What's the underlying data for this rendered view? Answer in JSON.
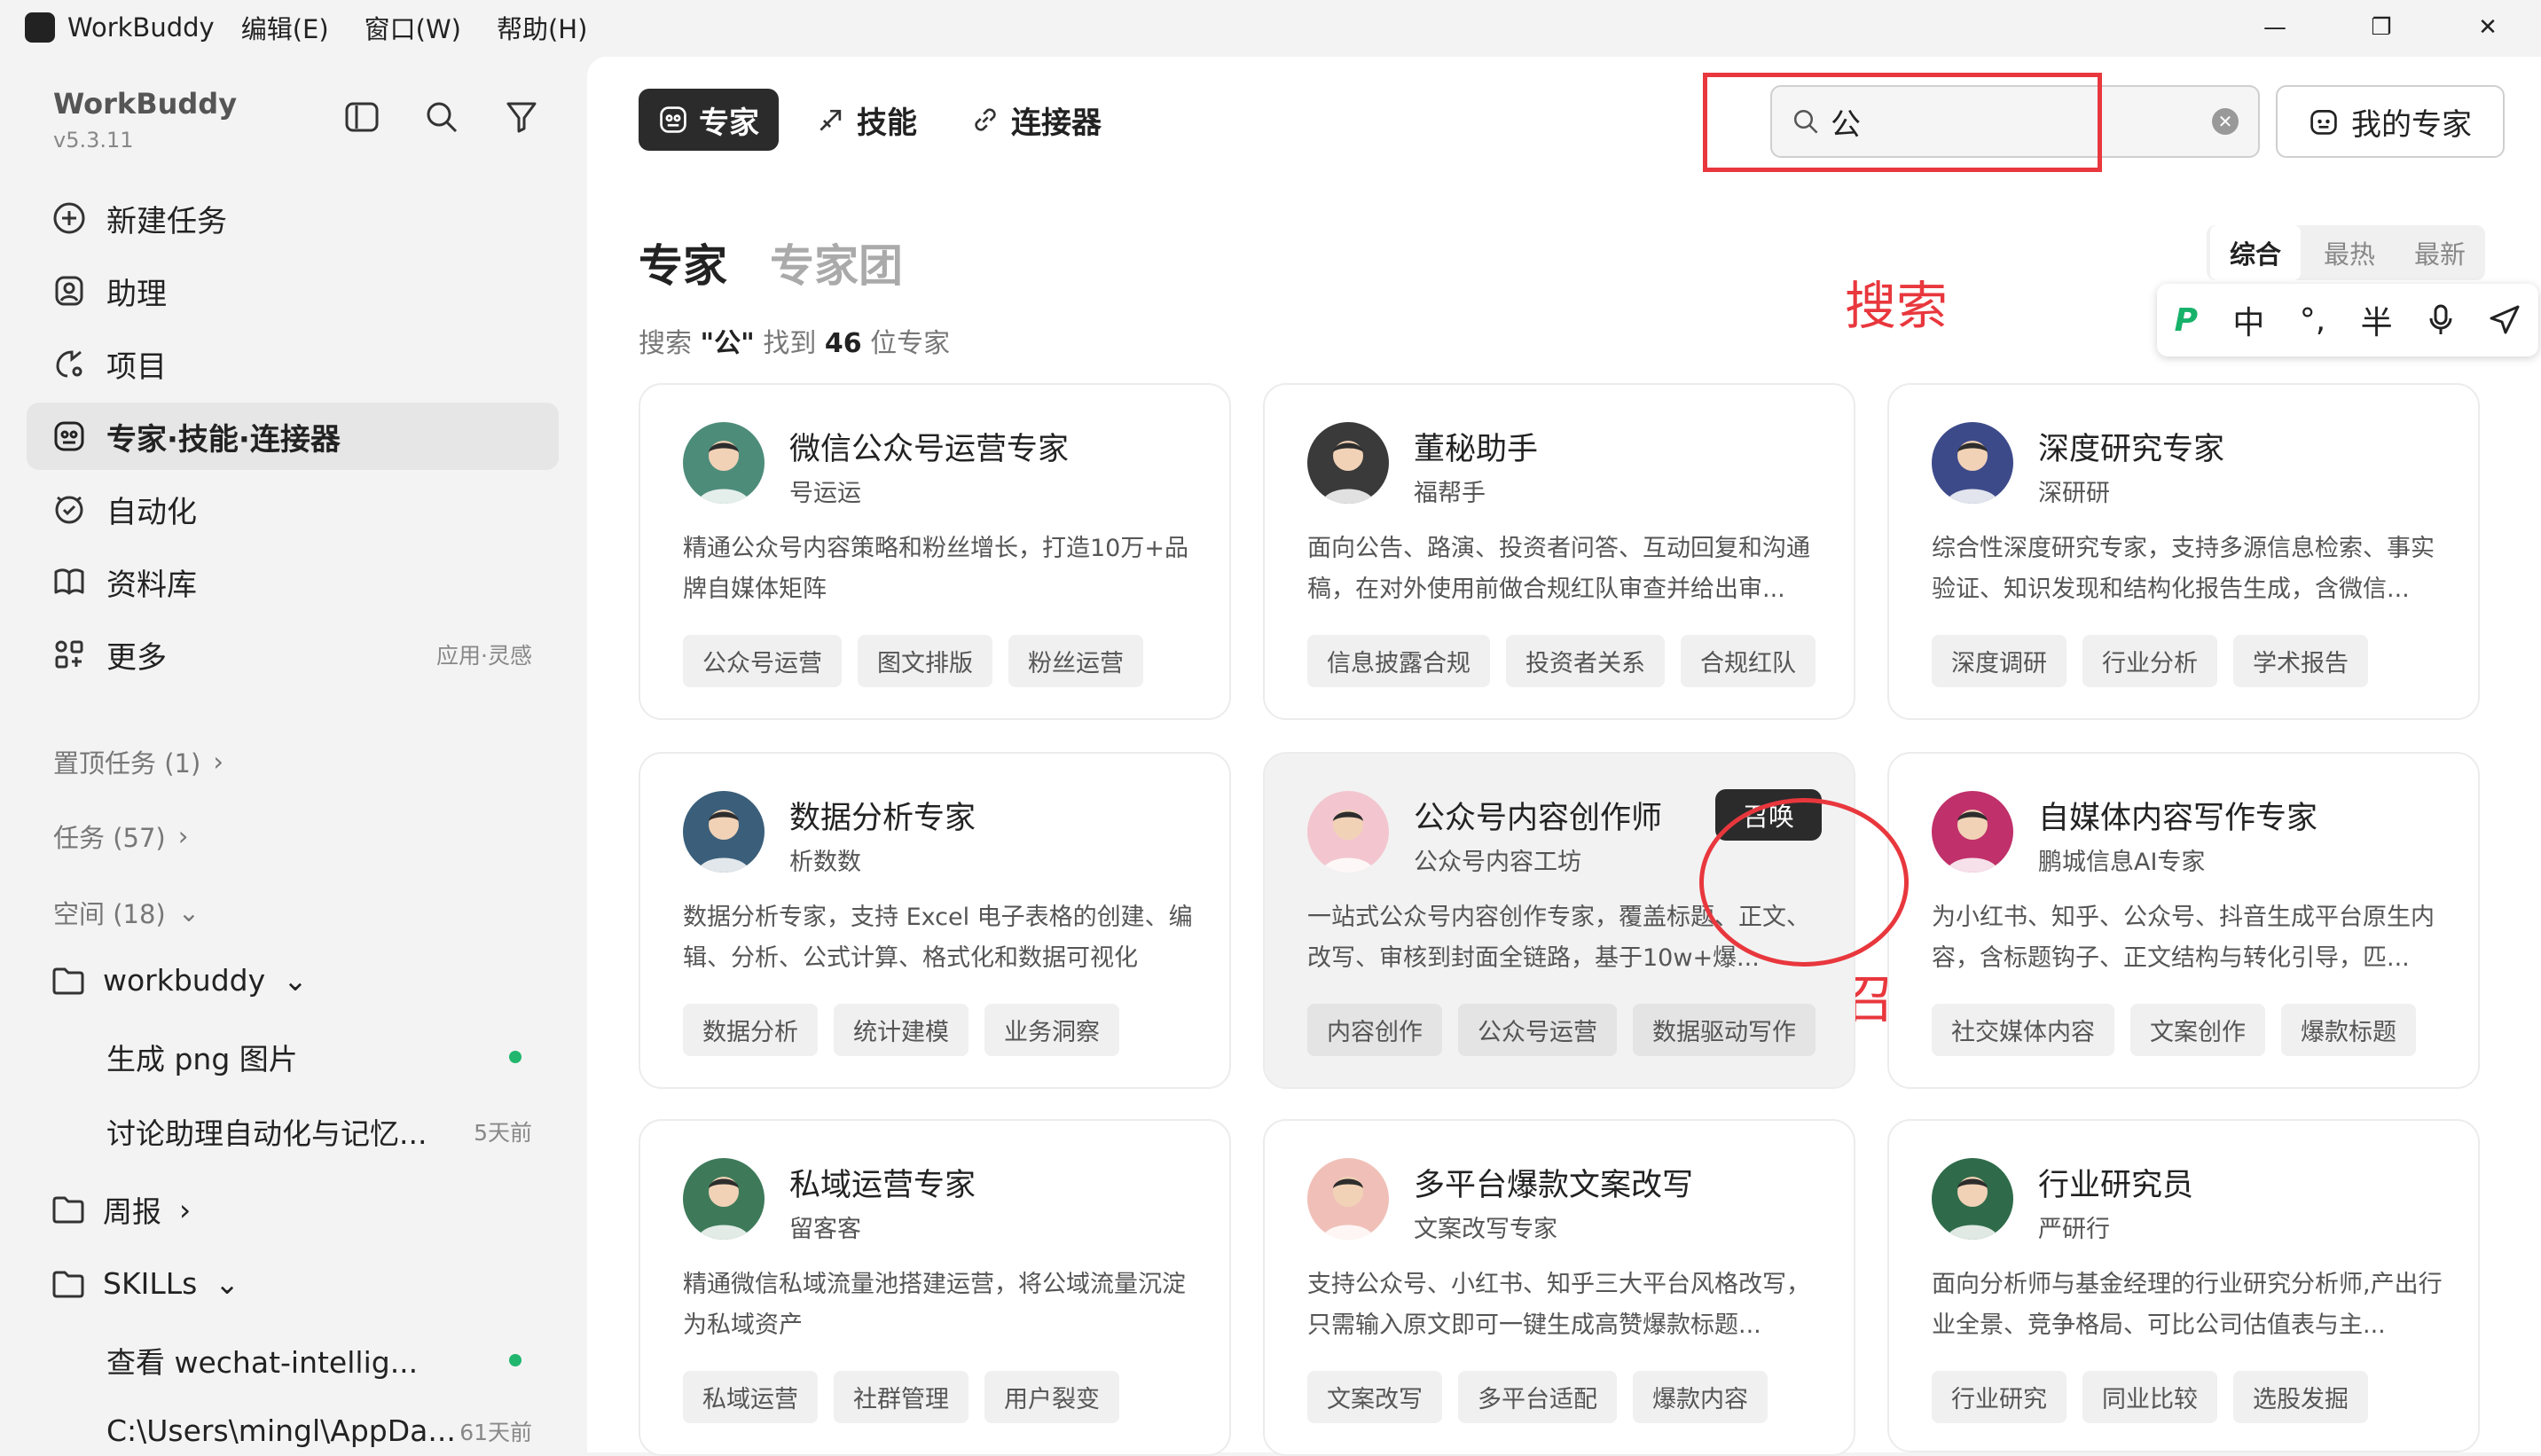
{
  "titlebar": {
    "app": "WorkBuddy",
    "menus": [
      "编辑(E)",
      "窗口(W)",
      "帮助(H)"
    ],
    "min": "—",
    "max": "❐",
    "close": "✕"
  },
  "sidebar": {
    "brand": "WorkBuddy",
    "version": "v5.3.11",
    "nav": [
      {
        "label": "新建任务",
        "icon": "plus-circle-icon"
      },
      {
        "label": "助理",
        "icon": "assistant-icon"
      },
      {
        "label": "项目",
        "icon": "project-icon"
      },
      {
        "label": "专家·技能·连接器",
        "icon": "expert-icon",
        "active": true
      },
      {
        "label": "自动化",
        "icon": "automation-icon"
      },
      {
        "label": "资料库",
        "icon": "book-icon"
      },
      {
        "label": "更多",
        "icon": "more-icon",
        "right": "应用·灵感"
      }
    ],
    "sections": {
      "pinned": "置顶任务 (1)",
      "tasks": "任务 (57)",
      "spaces": "空间 (18)"
    },
    "folders": [
      {
        "name": "workbuddy",
        "items": [
          {
            "label": "生成 png 图片",
            "dot": true
          },
          {
            "label": "讨论助理自动化与记忆...",
            "right": "5天前"
          }
        ]
      },
      {
        "name": "周报",
        "items": []
      },
      {
        "name": "SKILLs",
        "items": [
          {
            "label": "查看 wechat-intellig...",
            "dot": true
          },
          {
            "label": "C:\\Users\\mingl\\AppDa...",
            "right": "61天前"
          }
        ]
      }
    ]
  },
  "tabs": [
    {
      "label": "专家",
      "active": true
    },
    {
      "label": "技能"
    },
    {
      "label": "连接器"
    }
  ],
  "search": {
    "value": "公"
  },
  "my_experts": "我的专家",
  "heading": {
    "experts": "专家",
    "teams": "专家团"
  },
  "sort": [
    "综合",
    "最热",
    "最新"
  ],
  "result": {
    "prefix": "搜索 ",
    "query": "\"公\"",
    "mid": " 找到 ",
    "count": "46",
    "suffix": " 位专家"
  },
  "ime": [
    "中",
    "°,",
    "半"
  ],
  "annotations": {
    "search": "搜索",
    "summon": "召唤"
  },
  "summon_label": "召唤",
  "cards": [
    {
      "name": "微信公众号运营专家",
      "sub": "号运运",
      "desc": "精通公众号内容策略和粉丝增长，打造10万+品牌自媒体矩阵",
      "tags": [
        "公众号运营",
        "图文排版",
        "粉丝运营"
      ],
      "color": "#4e8c7a"
    },
    {
      "name": "董秘助手",
      "sub": "福帮手",
      "desc": "面向公告、路演、投资者问答、互动回复和沟通稿，在对外使用前做合规红队审查并给出审...",
      "tags": [
        "信息披露合规",
        "投资者关系",
        "合规红队"
      ],
      "color": "#3a3a3a"
    },
    {
      "name": "深度研究专家",
      "sub": "深研研",
      "desc": "综合性深度研究专家，支持多源信息检索、事实验证、知识发现和结构化报告生成，含微信...",
      "tags": [
        "深度调研",
        "行业分析",
        "学术报告"
      ],
      "color": "#3d4a8a"
    },
    {
      "name": "数据分析专家",
      "sub": "析数数",
      "desc": "数据分析专家，支持 Excel 电子表格的创建、编辑、分析、公式计算、格式化和数据可视化",
      "tags": [
        "数据分析",
        "统计建模",
        "业务洞察"
      ],
      "color": "#3b5f7a"
    },
    {
      "name": "公众号内容创作师",
      "sub": "公众号内容工坊",
      "desc": "一站式公众号内容创作专家，覆盖标题、正文、改写、审核到封面全链路，基于10w+爆...",
      "tags": [
        "内容创作",
        "公众号运营",
        "数据驱动写作"
      ],
      "color": "#f3c6cf",
      "hover": true
    },
    {
      "name": "自媒体内容写作专家",
      "sub": "鹏城信息AI专家",
      "desc": "为小红书、知乎、公众号、抖音生成平台原生内容，含标题钩子、正文结构与转化引导，匹...",
      "tags": [
        "社交媒体内容",
        "文案创作",
        "爆款标题"
      ],
      "color": "#c0306a"
    },
    {
      "name": "私域运营专家",
      "sub": "留客客",
      "desc": "精通微信私域流量池搭建运营，将公域流量沉淀为私域资产",
      "tags": [
        "私域运营",
        "社群管理",
        "用户裂变"
      ],
      "color": "#3e7a5a"
    },
    {
      "name": "多平台爆款文案改写",
      "sub": "文案改写专家",
      "desc": "支持公众号、小红书、知乎三大平台风格改写，只需输入原文即可一键生成高赞爆款标题...",
      "tags": [
        "文案改写",
        "多平台适配",
        "爆款内容"
      ],
      "color": "#f0c0b8"
    },
    {
      "name": "行业研究员",
      "sub": "严研行",
      "desc": "面向分析师与基金经理的行业研究分析师,产出行业全景、竞争格局、可比公司估值表与主...",
      "tags": [
        "行业研究",
        "同业比较",
        "选股发掘"
      ],
      "color": "#2f6b4a"
    }
  ]
}
